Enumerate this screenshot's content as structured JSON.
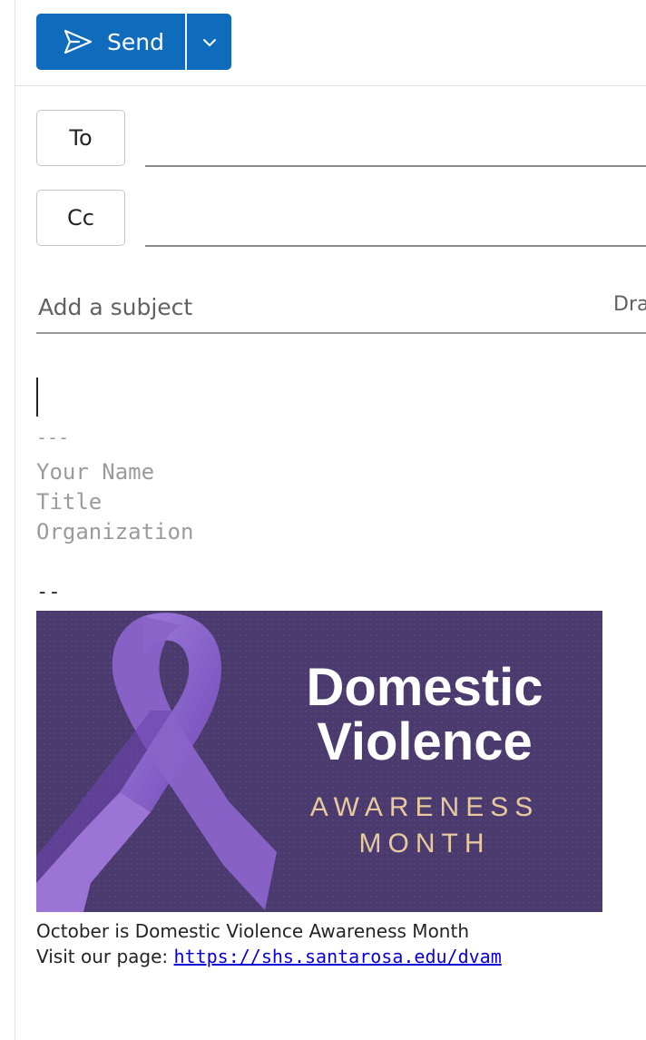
{
  "toolbar": {
    "send_label": "Send"
  },
  "recipients": {
    "to_label": "To",
    "to_value": "",
    "cc_label": "Cc",
    "cc_value": ""
  },
  "subject": {
    "placeholder": "Add a subject",
    "value": "",
    "draft_status": "Dra"
  },
  "signature": {
    "separator": "---",
    "name": "Your Name",
    "title": "Title",
    "organization": "Organization",
    "separator2": "--"
  },
  "banner": {
    "line1": "Domestic",
    "line2": "Violence",
    "line3": "AWARENESS",
    "line4": "MONTH",
    "colors": {
      "background": "#4b3a6e",
      "ribbon": "#8a63c9",
      "accent_text": "#e7c9a0"
    }
  },
  "footer": {
    "line1": "October is Domestic Violence Awareness Month",
    "line2_prefix": "Visit our page: ",
    "link_text": "https://shs.santarosa.edu/dvam"
  },
  "colors": {
    "accent": "#0f6cbd",
    "link": "#0a00d4"
  },
  "icons": [
    "send-icon",
    "chevron-down-icon",
    "ribbon-icon"
  ]
}
